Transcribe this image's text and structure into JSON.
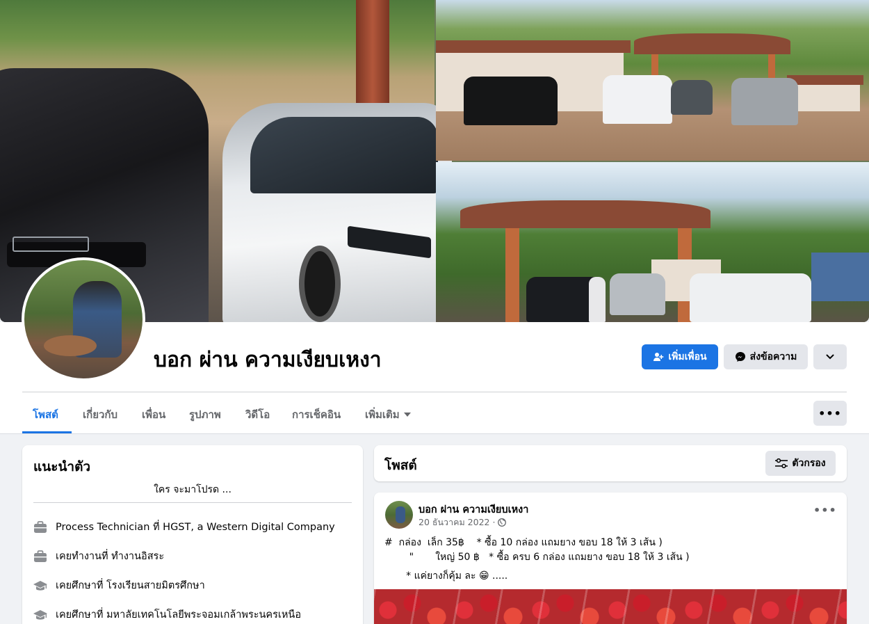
{
  "profile": {
    "name": "บอก ผ่าน ความเงียบเหงา"
  },
  "actions": {
    "add_friend": "เพิ่มเพื่อน",
    "message": "ส่งข้อความ"
  },
  "tabs": [
    {
      "label": "โพสต์",
      "active": true
    },
    {
      "label": "เกี่ยวกับ"
    },
    {
      "label": "เพื่อน"
    },
    {
      "label": "รูปภาพ"
    },
    {
      "label": "วิดีโอ"
    },
    {
      "label": "การเช็คอิน"
    },
    {
      "label": "เพิ่มเติม"
    }
  ],
  "intro": {
    "title": "แนะนำตัว",
    "bio": "ใคร จะมาโปรด ...",
    "items": [
      {
        "icon": "briefcase-icon",
        "text": "Process Technician ที่ HGST, a Western Digital Company"
      },
      {
        "icon": "briefcase-icon",
        "text": "เคยทำงานที่ ทำงานอิสระ"
      },
      {
        "icon": "graduation-cap-icon",
        "text": "เคยศึกษาที่ โรงเรียนสายมิตรศึกษา"
      },
      {
        "icon": "graduation-cap-icon",
        "text": "เคยศึกษาที่ มหาลัยเทคโนโลยีพระจอมเกล้าพระนครเหนือ"
      }
    ]
  },
  "posts": {
    "title": "โพสต์",
    "filter_label": "ตัวกรอง"
  },
  "post": {
    "author": "บอก ผ่าน ความเงียบเหงา",
    "date": "20 ธันวาคม 2022 ·",
    "lines": [
      "#  กล่อง  เล็ก 35฿    * ซื้อ 10 กล่อง แถมยาง ขอบ 18 ให้ 3 เส้น )",
      "        \"       ใหญ่ 50 ฿   * ซื้อ ครบ 6 กล่อง แถมยาง ขอบ 18 ให้ 3 เส้น )",
      "       * แค่ยางก็คุ้ม ละ 😁 ....."
    ]
  },
  "colors": {
    "primary": "#1b74e4",
    "background": "#f0f2f5",
    "secondary_button": "#e4e6eb"
  }
}
